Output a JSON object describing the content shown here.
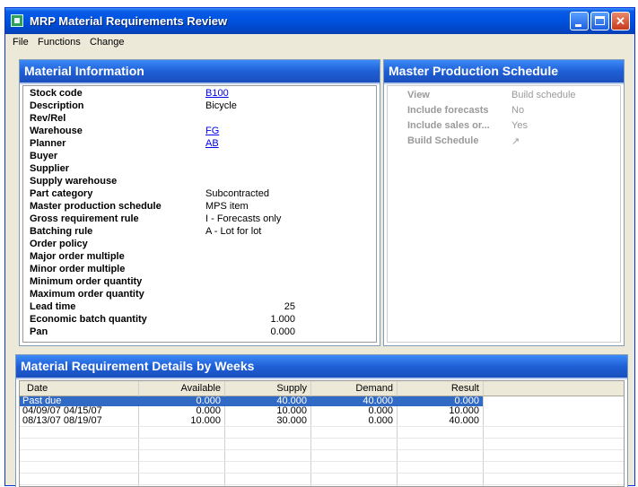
{
  "window": {
    "title": "MRP Material Requirements Review"
  },
  "menu": {
    "items": [
      "File",
      "Functions",
      "Change"
    ]
  },
  "material_info": {
    "header": "Material Information",
    "fields": [
      {
        "label": "Stock code",
        "value": "B100",
        "link": true
      },
      {
        "label": "Description",
        "value": "Bicycle"
      },
      {
        "label": "Rev/Rel",
        "value": ""
      },
      {
        "label": "Warehouse",
        "value": "FG",
        "link": true
      },
      {
        "label": "Planner",
        "value": "AB",
        "link": true
      },
      {
        "label": "Buyer",
        "value": ""
      },
      {
        "label": "Supplier",
        "value": ""
      },
      {
        "label": "Supply warehouse",
        "value": ""
      },
      {
        "label": "Part category",
        "value": "Subcontracted"
      },
      {
        "label": "Master production schedule",
        "value": "MPS item"
      },
      {
        "label": "Gross requirement rule",
        "value": "I - Forecasts only"
      },
      {
        "label": "Batching rule",
        "value": "A - Lot for lot"
      },
      {
        "label": "Order policy",
        "value": ""
      },
      {
        "label": "Major order multiple",
        "value": ""
      },
      {
        "label": "Minor order multiple",
        "value": ""
      },
      {
        "label": "Minimum order quantity",
        "value": ""
      },
      {
        "label": "Maximum order quantity",
        "value": ""
      },
      {
        "label": "Lead time",
        "value": "25",
        "numeric": true
      },
      {
        "label": "Economic batch quantity",
        "value": "1.000",
        "numeric": true
      },
      {
        "label": "Pan",
        "value": "0.000",
        "numeric": true
      }
    ]
  },
  "mps": {
    "header": "Master Production Schedule",
    "rows": [
      {
        "label": "View",
        "value": "Build schedule"
      },
      {
        "label": "Include forecasts",
        "value": "No"
      },
      {
        "label": "Include sales or...",
        "value": "Yes"
      },
      {
        "label": "Build Schedule",
        "value": "↗"
      }
    ]
  },
  "details": {
    "header": "Material Requirement Details by Weeks",
    "columns": [
      "Date",
      "Available",
      "Supply",
      "Demand",
      "Result"
    ],
    "rows": [
      [
        "Past due",
        "0.000",
        "40.000",
        "40.000",
        "0.000"
      ],
      [
        "04/09/07 04/15/07",
        "0.000",
        "10.000",
        "0.000",
        "10.000"
      ],
      [
        "08/13/07 08/19/07",
        "10.000",
        "30.000",
        "0.000",
        "40.000"
      ]
    ],
    "selected_row": 0
  }
}
